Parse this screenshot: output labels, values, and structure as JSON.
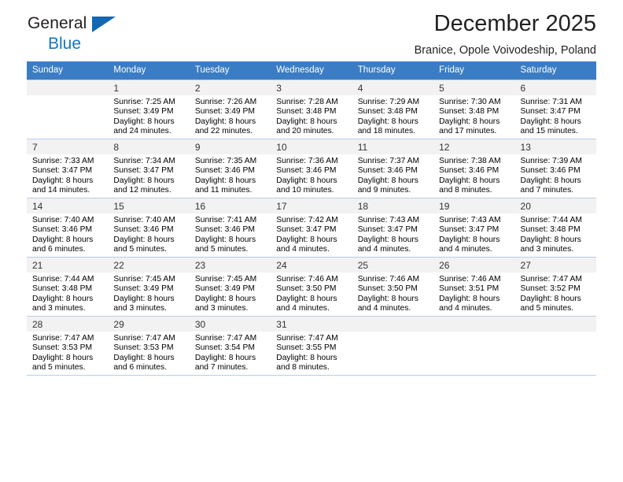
{
  "brand": {
    "line1": "General",
    "line2": "Blue",
    "triangle_color": "#1268b3"
  },
  "header": {
    "title": "December 2025",
    "subtitle": "Branice, Opole Voivodeship, Poland"
  },
  "theme": {
    "header_row_bg": "#3b7dc4",
    "daynum_bg": "#f2f2f2",
    "grid_line": "#b9cfe4"
  },
  "weekdays": [
    "Sunday",
    "Monday",
    "Tuesday",
    "Wednesday",
    "Thursday",
    "Friday",
    "Saturday"
  ],
  "weeks": [
    [
      {
        "day": "",
        "sunrise": "",
        "sunset": "",
        "daylight_line1": "",
        "daylight_line2": ""
      },
      {
        "day": "1",
        "sunrise": "Sunrise: 7:25 AM",
        "sunset": "Sunset: 3:49 PM",
        "daylight_line1": "Daylight: 8 hours",
        "daylight_line2": "and 24 minutes."
      },
      {
        "day": "2",
        "sunrise": "Sunrise: 7:26 AM",
        "sunset": "Sunset: 3:49 PM",
        "daylight_line1": "Daylight: 8 hours",
        "daylight_line2": "and 22 minutes."
      },
      {
        "day": "3",
        "sunrise": "Sunrise: 7:28 AM",
        "sunset": "Sunset: 3:48 PM",
        "daylight_line1": "Daylight: 8 hours",
        "daylight_line2": "and 20 minutes."
      },
      {
        "day": "4",
        "sunrise": "Sunrise: 7:29 AM",
        "sunset": "Sunset: 3:48 PM",
        "daylight_line1": "Daylight: 8 hours",
        "daylight_line2": "and 18 minutes."
      },
      {
        "day": "5",
        "sunrise": "Sunrise: 7:30 AM",
        "sunset": "Sunset: 3:48 PM",
        "daylight_line1": "Daylight: 8 hours",
        "daylight_line2": "and 17 minutes."
      },
      {
        "day": "6",
        "sunrise": "Sunrise: 7:31 AM",
        "sunset": "Sunset: 3:47 PM",
        "daylight_line1": "Daylight: 8 hours",
        "daylight_line2": "and 15 minutes."
      }
    ],
    [
      {
        "day": "7",
        "sunrise": "Sunrise: 7:33 AM",
        "sunset": "Sunset: 3:47 PM",
        "daylight_line1": "Daylight: 8 hours",
        "daylight_line2": "and 14 minutes."
      },
      {
        "day": "8",
        "sunrise": "Sunrise: 7:34 AM",
        "sunset": "Sunset: 3:47 PM",
        "daylight_line1": "Daylight: 8 hours",
        "daylight_line2": "and 12 minutes."
      },
      {
        "day": "9",
        "sunrise": "Sunrise: 7:35 AM",
        "sunset": "Sunset: 3:46 PM",
        "daylight_line1": "Daylight: 8 hours",
        "daylight_line2": "and 11 minutes."
      },
      {
        "day": "10",
        "sunrise": "Sunrise: 7:36 AM",
        "sunset": "Sunset: 3:46 PM",
        "daylight_line1": "Daylight: 8 hours",
        "daylight_line2": "and 10 minutes."
      },
      {
        "day": "11",
        "sunrise": "Sunrise: 7:37 AM",
        "sunset": "Sunset: 3:46 PM",
        "daylight_line1": "Daylight: 8 hours",
        "daylight_line2": "and 9 minutes."
      },
      {
        "day": "12",
        "sunrise": "Sunrise: 7:38 AM",
        "sunset": "Sunset: 3:46 PM",
        "daylight_line1": "Daylight: 8 hours",
        "daylight_line2": "and 8 minutes."
      },
      {
        "day": "13",
        "sunrise": "Sunrise: 7:39 AM",
        "sunset": "Sunset: 3:46 PM",
        "daylight_line1": "Daylight: 8 hours",
        "daylight_line2": "and 7 minutes."
      }
    ],
    [
      {
        "day": "14",
        "sunrise": "Sunrise: 7:40 AM",
        "sunset": "Sunset: 3:46 PM",
        "daylight_line1": "Daylight: 8 hours",
        "daylight_line2": "and 6 minutes."
      },
      {
        "day": "15",
        "sunrise": "Sunrise: 7:40 AM",
        "sunset": "Sunset: 3:46 PM",
        "daylight_line1": "Daylight: 8 hours",
        "daylight_line2": "and 5 minutes."
      },
      {
        "day": "16",
        "sunrise": "Sunrise: 7:41 AM",
        "sunset": "Sunset: 3:46 PM",
        "daylight_line1": "Daylight: 8 hours",
        "daylight_line2": "and 5 minutes."
      },
      {
        "day": "17",
        "sunrise": "Sunrise: 7:42 AM",
        "sunset": "Sunset: 3:47 PM",
        "daylight_line1": "Daylight: 8 hours",
        "daylight_line2": "and 4 minutes."
      },
      {
        "day": "18",
        "sunrise": "Sunrise: 7:43 AM",
        "sunset": "Sunset: 3:47 PM",
        "daylight_line1": "Daylight: 8 hours",
        "daylight_line2": "and 4 minutes."
      },
      {
        "day": "19",
        "sunrise": "Sunrise: 7:43 AM",
        "sunset": "Sunset: 3:47 PM",
        "daylight_line1": "Daylight: 8 hours",
        "daylight_line2": "and 4 minutes."
      },
      {
        "day": "20",
        "sunrise": "Sunrise: 7:44 AM",
        "sunset": "Sunset: 3:48 PM",
        "daylight_line1": "Daylight: 8 hours",
        "daylight_line2": "and 3 minutes."
      }
    ],
    [
      {
        "day": "21",
        "sunrise": "Sunrise: 7:44 AM",
        "sunset": "Sunset: 3:48 PM",
        "daylight_line1": "Daylight: 8 hours",
        "daylight_line2": "and 3 minutes."
      },
      {
        "day": "22",
        "sunrise": "Sunrise: 7:45 AM",
        "sunset": "Sunset: 3:49 PM",
        "daylight_line1": "Daylight: 8 hours",
        "daylight_line2": "and 3 minutes."
      },
      {
        "day": "23",
        "sunrise": "Sunrise: 7:45 AM",
        "sunset": "Sunset: 3:49 PM",
        "daylight_line1": "Daylight: 8 hours",
        "daylight_line2": "and 3 minutes."
      },
      {
        "day": "24",
        "sunrise": "Sunrise: 7:46 AM",
        "sunset": "Sunset: 3:50 PM",
        "daylight_line1": "Daylight: 8 hours",
        "daylight_line2": "and 4 minutes."
      },
      {
        "day": "25",
        "sunrise": "Sunrise: 7:46 AM",
        "sunset": "Sunset: 3:50 PM",
        "daylight_line1": "Daylight: 8 hours",
        "daylight_line2": "and 4 minutes."
      },
      {
        "day": "26",
        "sunrise": "Sunrise: 7:46 AM",
        "sunset": "Sunset: 3:51 PM",
        "daylight_line1": "Daylight: 8 hours",
        "daylight_line2": "and 4 minutes."
      },
      {
        "day": "27",
        "sunrise": "Sunrise: 7:47 AM",
        "sunset": "Sunset: 3:52 PM",
        "daylight_line1": "Daylight: 8 hours",
        "daylight_line2": "and 5 minutes."
      }
    ],
    [
      {
        "day": "28",
        "sunrise": "Sunrise: 7:47 AM",
        "sunset": "Sunset: 3:53 PM",
        "daylight_line1": "Daylight: 8 hours",
        "daylight_line2": "and 5 minutes."
      },
      {
        "day": "29",
        "sunrise": "Sunrise: 7:47 AM",
        "sunset": "Sunset: 3:53 PM",
        "daylight_line1": "Daylight: 8 hours",
        "daylight_line2": "and 6 minutes."
      },
      {
        "day": "30",
        "sunrise": "Sunrise: 7:47 AM",
        "sunset": "Sunset: 3:54 PM",
        "daylight_line1": "Daylight: 8 hours",
        "daylight_line2": "and 7 minutes."
      },
      {
        "day": "31",
        "sunrise": "Sunrise: 7:47 AM",
        "sunset": "Sunset: 3:55 PM",
        "daylight_line1": "Daylight: 8 hours",
        "daylight_line2": "and 8 minutes."
      },
      {
        "day": "",
        "sunrise": "",
        "sunset": "",
        "daylight_line1": "",
        "daylight_line2": ""
      },
      {
        "day": "",
        "sunrise": "",
        "sunset": "",
        "daylight_line1": "",
        "daylight_line2": ""
      },
      {
        "day": "",
        "sunrise": "",
        "sunset": "",
        "daylight_line1": "",
        "daylight_line2": ""
      }
    ]
  ]
}
